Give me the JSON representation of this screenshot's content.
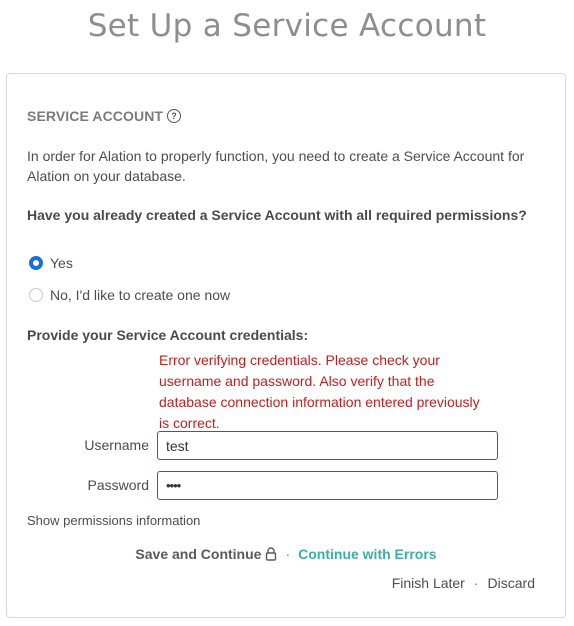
{
  "page": {
    "title": "Set Up a Service Account"
  },
  "section": {
    "title": "SERVICE ACCOUNT",
    "help_icon": "question-circle-icon",
    "intro": "In order for Alation to properly function, you need to create a Service Account for Alation on your database."
  },
  "question": {
    "text": "Have you already created a Service Account with all required permissions?",
    "options": [
      {
        "label": "Yes",
        "selected": true
      },
      {
        "label": "No, I'd like to create one now",
        "selected": false
      }
    ]
  },
  "credentials": {
    "title": "Provide your Service Account credentials:",
    "error": "Error verifying credentials. Please check your username and password. Also verify that the database connection information entered previously is correct.",
    "username_label": "Username",
    "username_value": "test",
    "password_label": "Password",
    "password_value": "test",
    "error_color": "#c71c1c"
  },
  "show_permissions": "Show permissions information",
  "actions": {
    "save_label": "Save and Continue",
    "save_icon": "lock-icon",
    "separator": "·",
    "continue_label": "Continue with Errors",
    "continue_color": "#3aafa9"
  },
  "secondary_actions": {
    "finish_later": "Finish Later",
    "separator": "·",
    "discard": "Discard"
  }
}
